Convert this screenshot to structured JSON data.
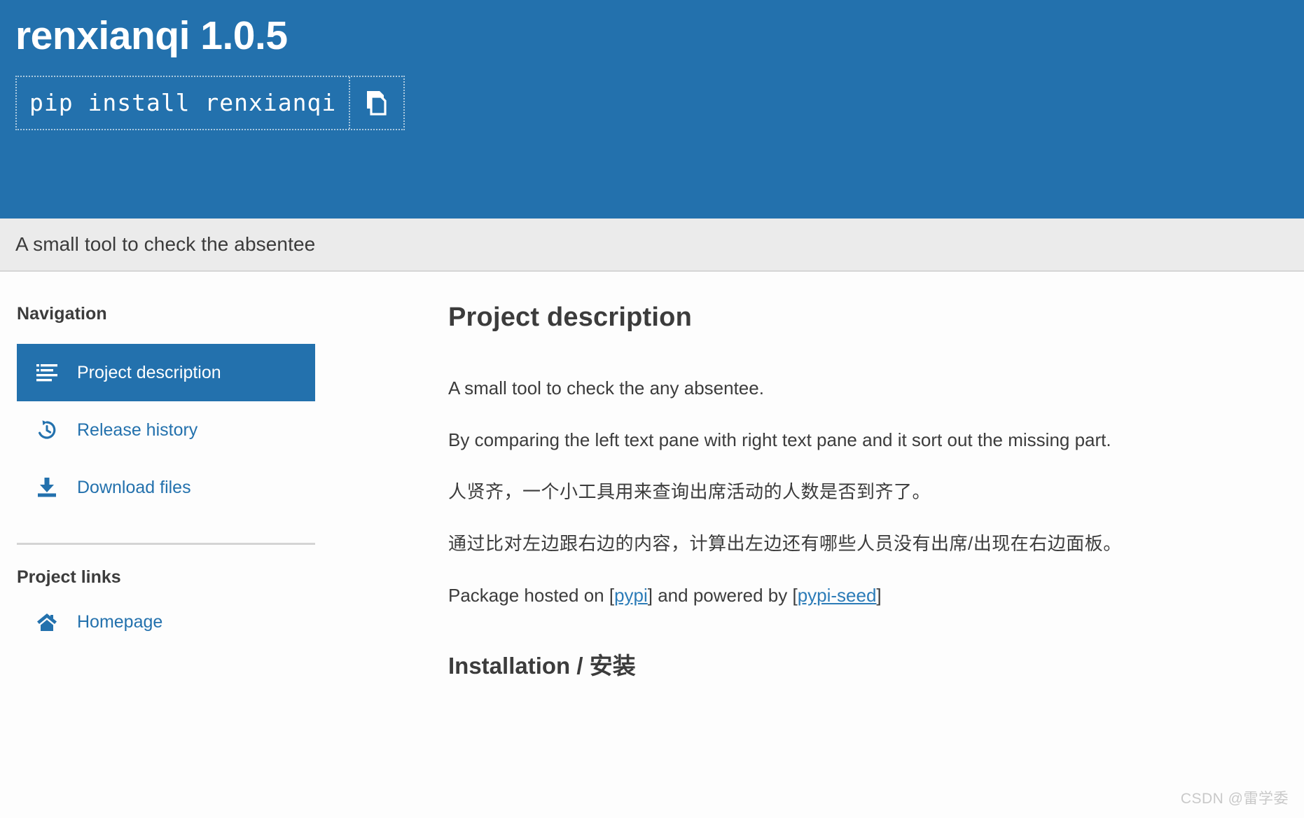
{
  "header": {
    "project_title": "renxianqi 1.0.5",
    "install_command": "pip install renxianqi",
    "copy_icon": "copy-icon",
    "banner_color": "#2371AD"
  },
  "summary": {
    "text": "A small tool to check the absentee"
  },
  "sidebar": {
    "navigation_heading": "Navigation",
    "nav_items": [
      {
        "label": "Project description",
        "icon": "list-lines-icon",
        "active": true
      },
      {
        "label": "Release history",
        "icon": "history-clock-icon",
        "active": false
      },
      {
        "label": "Download files",
        "icon": "download-icon",
        "active": false
      }
    ],
    "project_links_heading": "Project links",
    "links": [
      {
        "label": "Homepage",
        "icon": "home-icon"
      }
    ]
  },
  "main": {
    "title": "Project description",
    "paragraphs": [
      "A small tool to check the any absentee.",
      "By comparing the left text pane with right text pane and it sort out the missing part.",
      "人贤齐，一个小工具用来查询出席活动的人数是否到齐了。",
      "通过比对左边跟右边的内容，计算出左边还有哪些人员没有出席/出现在右边面板。"
    ],
    "hosted_line": {
      "prefix": "Package hosted on [",
      "link1": "pypi",
      "middle": "] and powered by [",
      "link2": "pypi-seed",
      "suffix": "]"
    },
    "installation_heading": "Installation / 安装"
  },
  "watermark": {
    "text": "CSDN @雷学委"
  }
}
